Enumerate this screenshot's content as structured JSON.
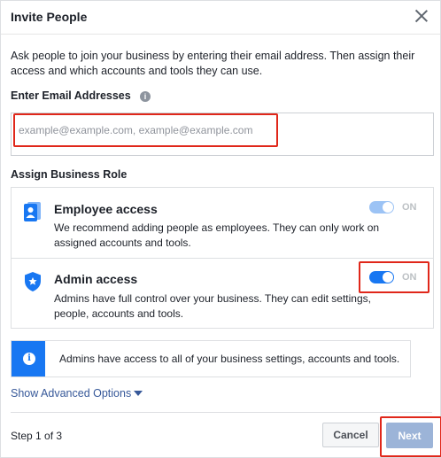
{
  "dialog": {
    "title": "Invite People",
    "description": "Ask people to join your business by entering their email address. Then assign their access and which accounts and tools they can use."
  },
  "email": {
    "label": "Enter Email Addresses",
    "info_icon": "info-icon",
    "placeholder": "example@example.com, example@example.com",
    "value": ""
  },
  "roles": {
    "label": "Assign Business Role",
    "items": [
      {
        "title": "Employee access",
        "description": "We recommend adding people as employees. They can only work on assigned accounts and tools.",
        "icon": "employee-badge-icon",
        "toggle_state": "ON",
        "toggle_on": true,
        "toggle_color": "#9cc3f5"
      },
      {
        "title": "Admin access",
        "description": "Admins have full control over your business. They can edit settings, people, accounts and tools.",
        "icon": "admin-shield-icon",
        "toggle_state": "ON",
        "toggle_on": true,
        "toggle_color": "#1877f2"
      }
    ]
  },
  "notice": {
    "icon": "info-icon",
    "text": "Admins have access to all of your business settings, accounts and tools."
  },
  "advanced": {
    "label": "Show Advanced Options",
    "icon": "caret-down-icon"
  },
  "footer": {
    "step": "Step 1 of 3",
    "cancel_label": "Cancel",
    "next_label": "Next"
  },
  "colors": {
    "accent": "#1877f2",
    "highlight": "#e0271a",
    "link": "#365899"
  }
}
